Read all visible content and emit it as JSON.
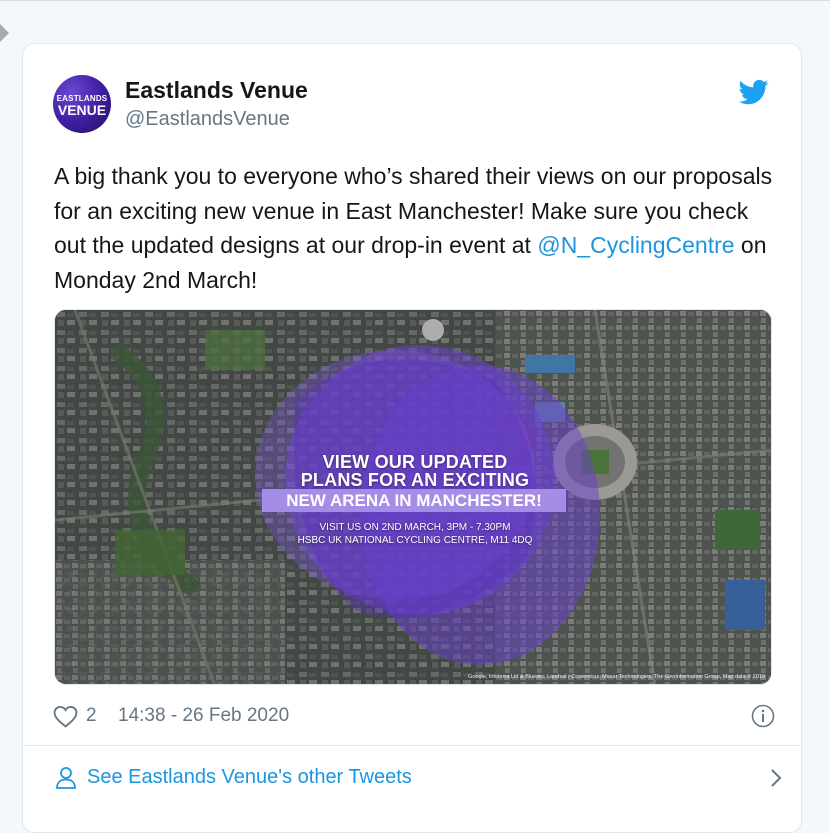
{
  "account": {
    "name": "Eastlands Venue",
    "handle": "@EastlandsVenue",
    "avatar_text_top": "EASTLANDS",
    "avatar_text_bottom": "VENUE"
  },
  "tweet": {
    "text_before": "A big thank you to everyone who’s shared their views on our proposals for an exciting new venue in East Manchester! Make sure you check out the updated designs at our drop-in event at ",
    "mention": "@N_CyclingCentre",
    "text_after": " on Monday 2nd March!",
    "likes": "2",
    "timestamp": "14:38 - 26 Feb 2020"
  },
  "media": {
    "headline_line1": "VIEW OUR UPDATED",
    "headline_line2": "PLANS FOR AN EXCITING",
    "headline_line3": "NEW ARENA IN MANCHESTER!",
    "visit_line1": "VISIT US ON 2ND MARCH, 3PM - 7.30PM",
    "visit_line2": "HSBC UK NATIONAL CYCLING CENTRE, M11 4DQ",
    "map_credit": "Google, Infoterra Ltd & Bluesky, Landsat / Copernicus, Maxar Technologies, The GeoInformation Group, Map data © 2019"
  },
  "footer": {
    "see_more_label": "See Eastlands Venue's other Tweets"
  },
  "icons": {
    "twitter": "twitter-bird-icon",
    "like": "heart-icon",
    "info": "info-icon",
    "person": "person-icon",
    "chevron": "chevron-right-icon"
  },
  "colors": {
    "link": "#1b95e0",
    "twitter_blue": "#1da1f2",
    "text": "#14171a",
    "muted": "#657786",
    "brand_purple": "#4b2bb5"
  }
}
